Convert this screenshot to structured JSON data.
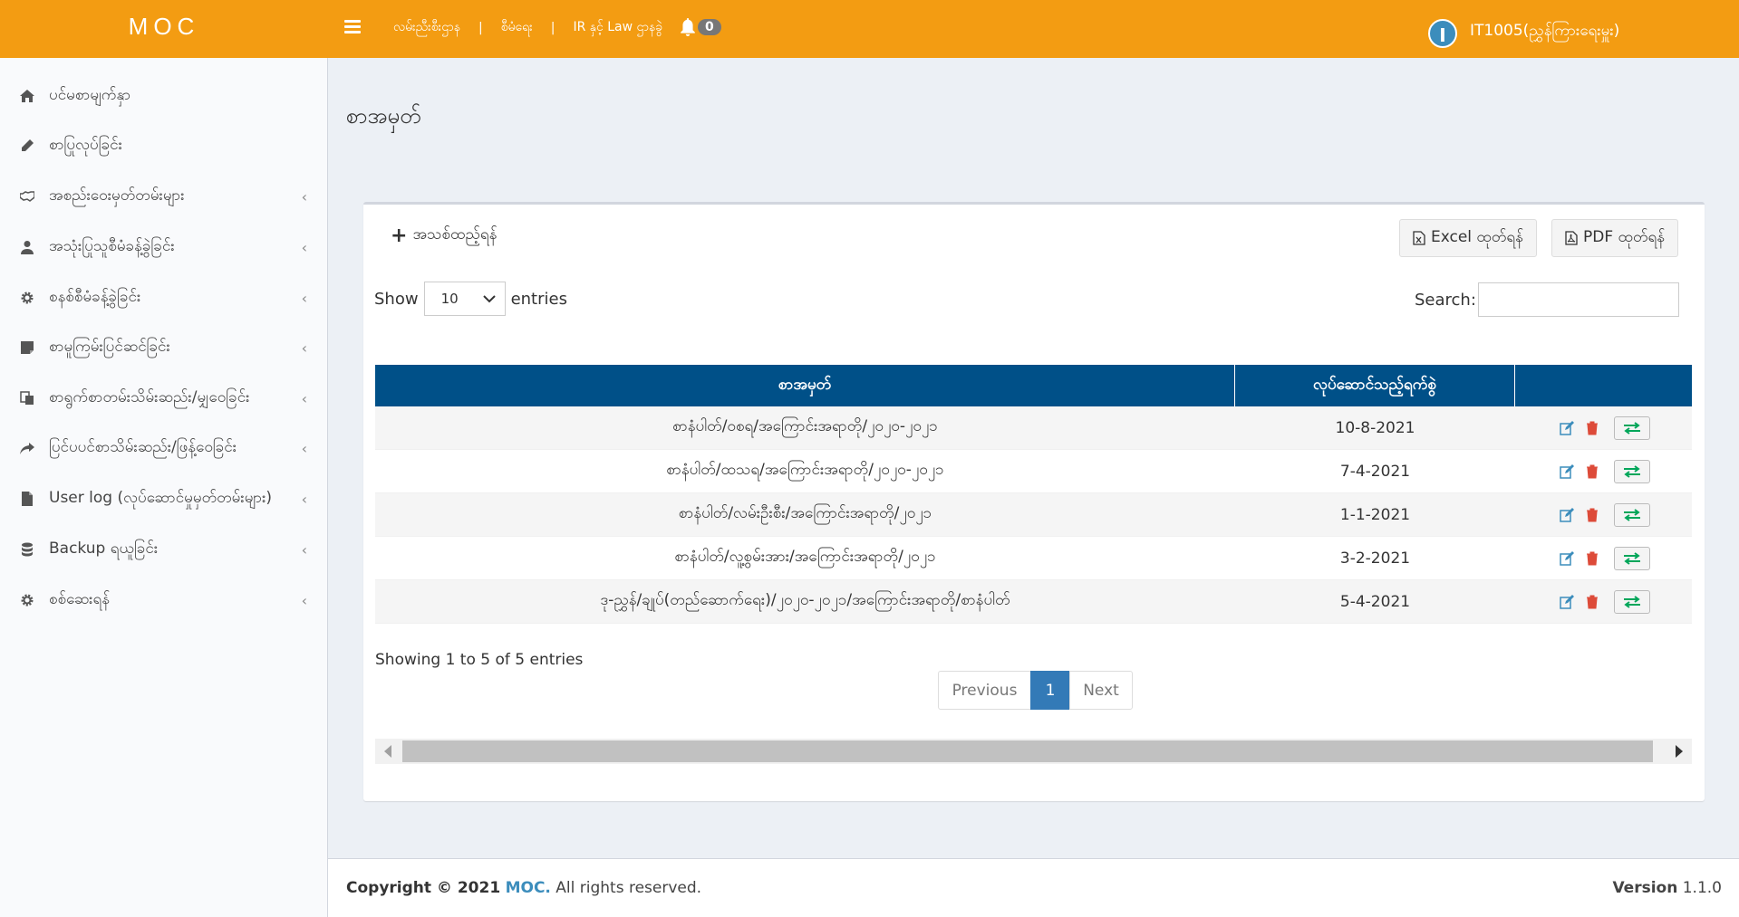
{
  "header": {
    "logo": "MOC",
    "nav": [
      "လမ်းညီးစီးဌာန",
      "စီမံရေး",
      "IR နှင့် Law ဌာနခွဲ"
    ],
    "nav_sep": "|",
    "notification_count": "0",
    "user_initial": "I",
    "user_name": "IT1005(ညွှန်ကြားရေးမှူး)"
  },
  "sidebar": {
    "items": [
      {
        "label": "ပင်မစာမျက်နှာ",
        "icon": "home-icon",
        "chevron": ""
      },
      {
        "label": "စာပြုလုပ်ခြင်း",
        "icon": "pencil-icon",
        "chevron": ""
      },
      {
        "label": "အစည်းဝေးမှတ်တမ်းများ",
        "icon": "handshake-icon",
        "chevron": "‹"
      },
      {
        "label": "အသုံးပြုသူစီမံခန့်ခွဲခြင်း",
        "icon": "user-icon",
        "chevron": "‹"
      },
      {
        "label": "စနစ်စီမံခန့်ခွဲခြင်း",
        "icon": "gear-icon",
        "chevron": "‹"
      },
      {
        "label": "စာမူကြမ်းပြင်ဆင်ခြင်း",
        "icon": "note-icon",
        "chevron": "‹"
      },
      {
        "label": "စာရွက်စာတမ်းသိမ်းဆည်း/မျှဝေခြင်း",
        "icon": "copy-icon",
        "chevron": "‹"
      },
      {
        "label": "ပြင်ပပင်စာသိမ်းဆည်း/ဖြန့်ဝေခြင်း",
        "icon": "share-icon",
        "chevron": "‹"
      },
      {
        "label": "User log (လုပ်ဆောင်မှုမှတ်တမ်းများ)",
        "icon": "file-icon",
        "chevron": "‹"
      },
      {
        "label": "Backup ရယူခြင်း",
        "icon": "database-icon",
        "chevron": "‹"
      },
      {
        "label": "စစ်ဆေးရန်",
        "icon": "gear-icon",
        "chevron": "‹"
      }
    ]
  },
  "main": {
    "page_title": "စာအမှတ်",
    "add_label": "အသစ်ထည့်ရန်",
    "excel_label": "Excel ထုတ်ရန်",
    "pdf_label": "PDF ထုတ်ရန်",
    "show_label": "Show",
    "page_size": "10",
    "entries_label": "entries",
    "search_label": "Search:",
    "search_value": "",
    "columns": [
      "စာအမှတ်",
      "လုပ်ဆောင်သည့်ရက်စွဲ",
      ""
    ],
    "rows": [
      {
        "number": "စာနံပါတ်/ဝစရ/အကြောင်းအရာတို/၂၀၂၀-၂၀၂၁",
        "date": "10-8-2021"
      },
      {
        "number": "စာနံပါတ်/ထသရ/အကြောင်းအရာတို/၂၀၂၀-၂၀၂၁",
        "date": "7-4-2021"
      },
      {
        "number": "စာနံပါတ်/လမ်းဦးစီး/အကြောင်းအရာတို/၂၀၂၁",
        "date": "1-1-2021"
      },
      {
        "number": "စာနံပါတ်/လူ့စွမ်းအား/အကြောင်းအရာတို/၂၀၂၁",
        "date": "3-2-2021"
      },
      {
        "number": "ဒု-ညွှန်/ချုပ်(တည်ဆောက်ရေး)/၂၀၂၀-၂၀၂၁/အကြောင်းအရာတို/စာနံပါတ်",
        "date": "5-4-2021"
      }
    ],
    "info": "Showing 1 to 5 of 5 entries",
    "pager": {
      "previous": "Previous",
      "current": "1",
      "next": "Next"
    }
  },
  "footer": {
    "copyright": "Copyright © 2021",
    "brand": "MOC.",
    "rights": "All rights reserved.",
    "version_label": "Version",
    "version": "1.1.0"
  },
  "colors": {
    "header": "#f39c12",
    "table_header": "#005088",
    "edit": "#3c8dbc",
    "delete": "#dd4b39",
    "transfer": "#00a65a"
  }
}
